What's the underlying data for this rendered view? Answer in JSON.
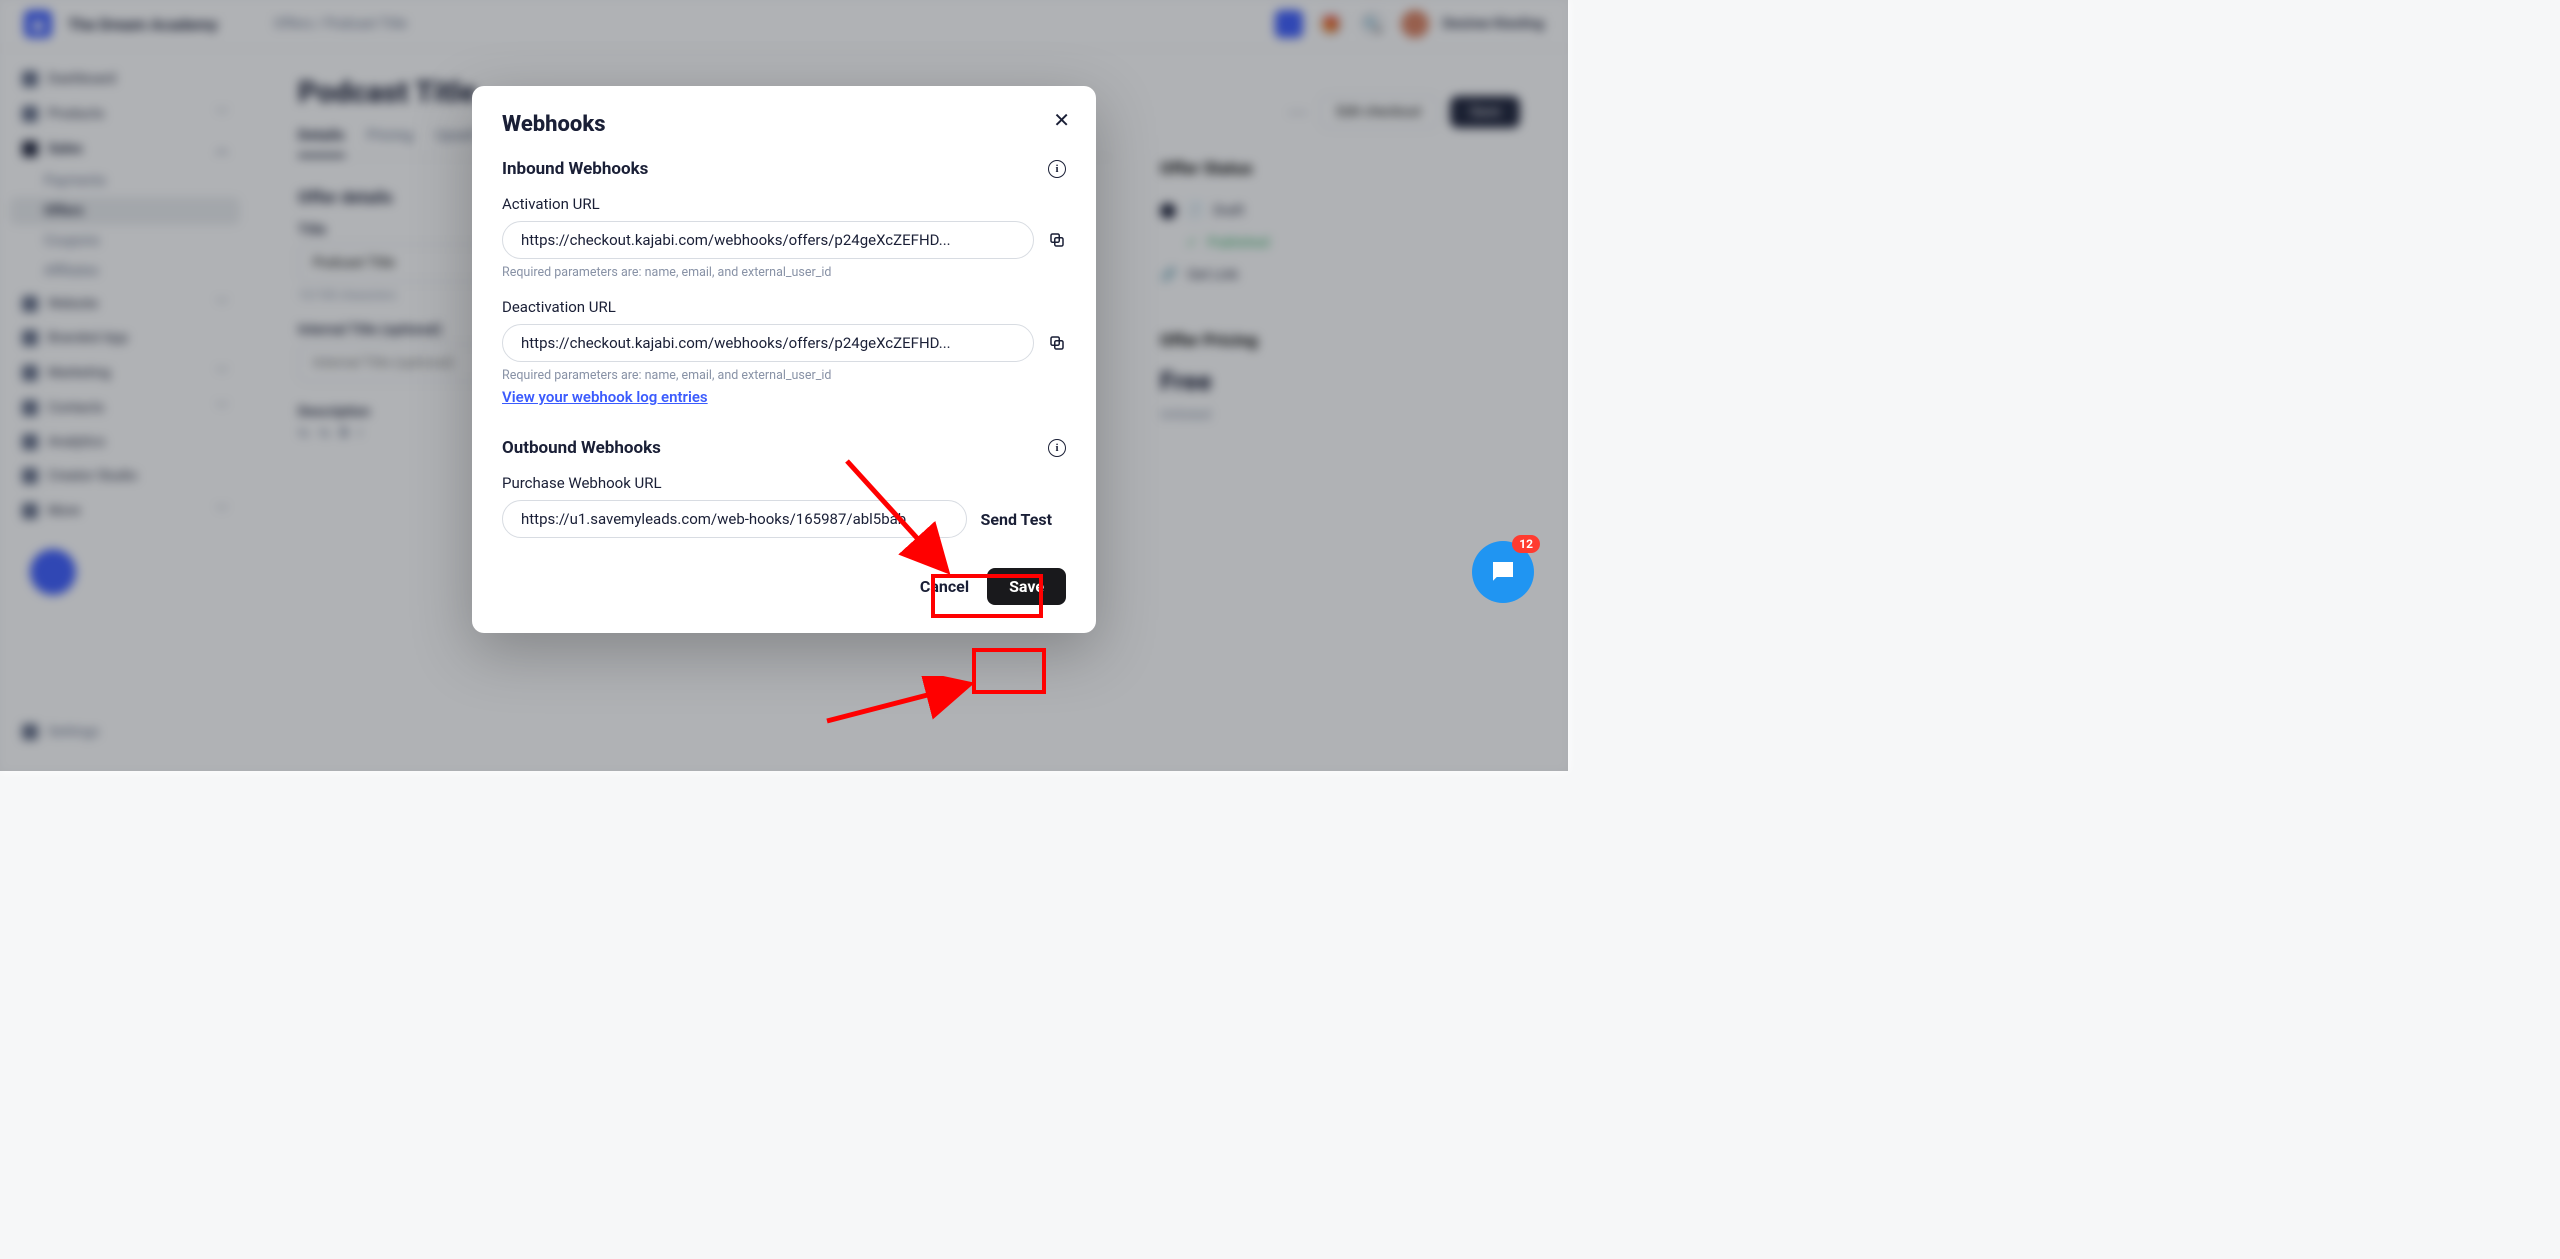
{
  "brand": "The Dream Academy",
  "breadcrumb": {
    "offers": "Offers",
    "sep": "/",
    "current": "Podcast Title"
  },
  "topbar": {
    "user": "Desiree Kiesling"
  },
  "sidebar": {
    "dashboard": "Dashboard",
    "products": "Products",
    "sales": "Sales",
    "payments": "Payments",
    "offers": "Offers",
    "coupons": "Coupons",
    "affiliates": "Affiliates",
    "website": "Website",
    "branded": "Branded App",
    "marketing": "Marketing",
    "contacts": "Contacts",
    "analytics": "Analytics",
    "creator": "Creator Studio",
    "more": "More",
    "settings": "Settings"
  },
  "page": {
    "title": "Podcast Title",
    "tabs": {
      "details": "Details",
      "pricing": "Pricing",
      "upsell": "Upsell"
    },
    "details_h": "Offer details",
    "title_lbl": "Title",
    "title_val": "Podcast Title",
    "title_helper": "13/100 characters",
    "internal_lbl": "Internal Title (optional)",
    "internal_ph": "Internal Title (optional)",
    "desc_lbl": "Description",
    "actions": {
      "edit": "Edit checkout",
      "save": "Save"
    },
    "status_h": "Offer Status",
    "draft": "Draft",
    "published": "Published",
    "getlink": "Get Link",
    "pricing_h": "Offer Pricing",
    "free": "Free",
    "unlisted": "Unlisted"
  },
  "modal": {
    "title": "Webhooks",
    "inbound_h": "Inbound Webhooks",
    "activation_lbl": "Activation URL",
    "activation_url": "https://checkout.kajabi.com/webhooks/offers/p24geXcZEFHD...",
    "deactivation_lbl": "Deactivation URL",
    "deactivation_url": "https://checkout.kajabi.com/webhooks/offers/p24geXcZEFHD...",
    "required_params": "Required parameters are: name, email, and external_user_id",
    "log_link": "View your webhook log entries",
    "outbound_h": "Outbound Webhooks",
    "purchase_lbl": "Purchase Webhook URL",
    "purchase_url": "https://u1.savemyleads.com/web-hooks/165987/abl5bab",
    "send_test": "Send Test",
    "cancel": "Cancel",
    "save": "Save"
  },
  "chat": {
    "badge": "12"
  }
}
